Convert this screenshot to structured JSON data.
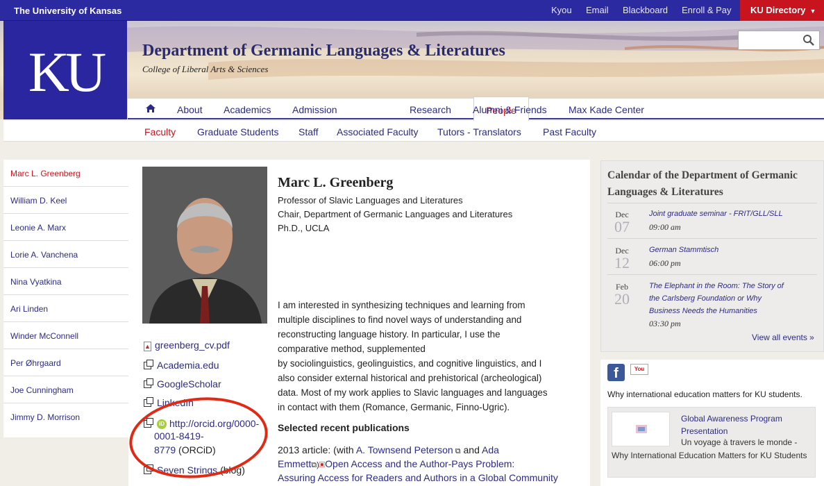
{
  "topbar": {
    "university": "The University of Kansas",
    "links": [
      "Kyou",
      "Email",
      "Blackboard",
      "Enroll & Pay"
    ],
    "directory": "KU Directory"
  },
  "header": {
    "logo": "KU",
    "title": "Department of Germanic Languages & Literatures",
    "subtitle": "College of Liberal Arts & Sciences"
  },
  "nav": {
    "items": [
      "About",
      "Academics",
      "Admission",
      "People",
      "Research",
      "Alumni & Friends",
      "Max Kade Center"
    ],
    "active": "People"
  },
  "subnav": [
    "Faculty",
    "Graduate Students",
    "Staff",
    "Associated Faculty",
    "Tutors - Translators",
    "Past Faculty"
  ],
  "sidebar": [
    "Marc L. Greenberg",
    "William D. Keel",
    "Leonie A. Marx",
    "Lorie A. Vanchena",
    "Nina Vyatkina",
    "Ari Linden",
    "Winder McConnell",
    "Per Øhrgaard",
    "Joe Cunningham",
    "Jimmy D. Morrison"
  ],
  "profile": {
    "name": "Marc L. Greenberg",
    "roles": [
      "Professor of Slavic Languages and Literatures",
      "Chair, Department of Germanic Languages and Literatures",
      "Ph.D., UCLA"
    ],
    "bio_lines": [
      "I am interested in synthesizing techniques and learning from",
      "multiple disciplines to find novel ways of understanding and",
      "reconstructing language history. In particular, I use the",
      "comparative method, supplemented",
      "by sociolinguistics, geolinguistics, and cognitive linguistics, and I",
      "also consider external historical and prehistorical (archeological)",
      "data. Most of my work applies to Slavic languages and languages",
      "in contact with them (Romance, Germanic, Finno-Ugric)."
    ],
    "pubs_heading": "Selected recent publications",
    "pub_line1_a": "2013 article: (with ",
    "pub_line1_link1": "A. Townsend Peterson",
    "pub_line1_b": " and ",
    "pub_line1_link2": "Ada",
    "pub_line2_link": "Emmett",
    "pub_line2_title": "Open Access and the Author-Pays Problem:",
    "pub_line3": "Assuring Access for Readers and Authors in a Global Community"
  },
  "links": {
    "cv": "greenberg_cv.pdf",
    "academia": "Academia.edu",
    "scholar": "GoogleScholar",
    "linkedin": "LinkedIn",
    "orcid_url1": "http://orcid.org/0000-",
    "orcid_url2": "0001-8419-",
    "orcid_url3": "8779",
    "orcid_suffix": "(ORCiD)",
    "orcid_badge": "iD",
    "blog_link": "Seven Strings",
    "blog_suffix": "(blog)"
  },
  "calendar": {
    "title": "Calendar of the Department of Germanic Languages & Literatures",
    "events": [
      {
        "month": "Dec",
        "day": "07",
        "title_lines": [
          "Joint graduate seminar - FRIT/GLL/SLL"
        ],
        "time": "09:00 am"
      },
      {
        "month": "Dec",
        "day": "12",
        "title_lines": [
          "German Stammtisch"
        ],
        "time": "06:00 pm"
      },
      {
        "month": "Feb",
        "day": "20",
        "title_lines": [
          "The Elephant in the Room: The Story of",
          "the Carlsberg Foundation or Why",
          "Business Needs the Humanities"
        ],
        "time": "03:30 pm"
      }
    ],
    "view_all": "View all events »"
  },
  "social": {
    "facebook": "f",
    "youtube": "You",
    "tagline": "Why international education matters for KU students.",
    "promo_title": "Global Awareness Program Presentation",
    "promo_text1": "Un voyage à travers le monde -",
    "promo_text2": "Why International Education Matters for KU Students"
  },
  "colors": {
    "ku_blue": "#2c2aa0",
    "ku_red": "#c8141e",
    "link": "#2b2b85",
    "highlight_oval": "#e02a14"
  }
}
